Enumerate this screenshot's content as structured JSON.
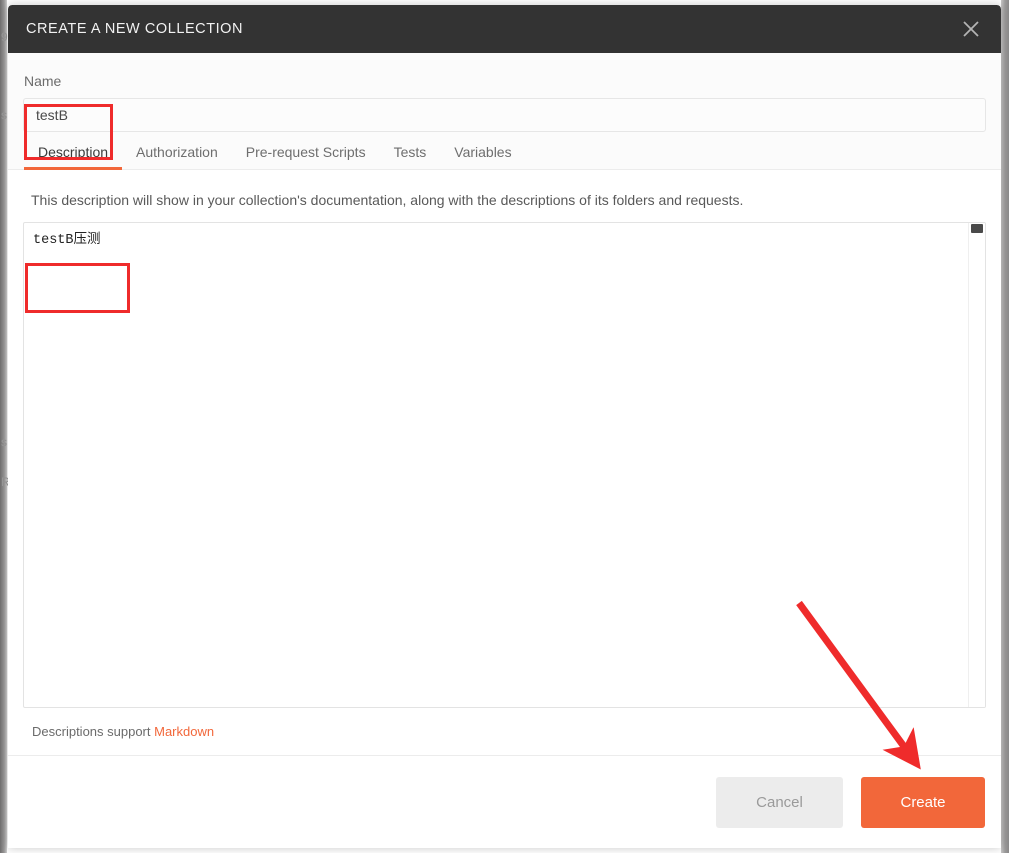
{
  "modal": {
    "title": "CREATE A NEW COLLECTION",
    "close_icon": "close-icon"
  },
  "name_section": {
    "label": "Name",
    "value": "testB",
    "placeholder": ""
  },
  "tabs": [
    {
      "label": "Description",
      "active": true
    },
    {
      "label": "Authorization",
      "active": false
    },
    {
      "label": "Pre-request Scripts",
      "active": false
    },
    {
      "label": "Tests",
      "active": false
    },
    {
      "label": "Variables",
      "active": false
    }
  ],
  "description": {
    "hint": "This description will show in your collection's documentation, along with the descriptions of its folders and requests.",
    "value": "testB压测",
    "placeholder": "",
    "markdown_note_prefix": "Descriptions support ",
    "markdown_link": "Markdown"
  },
  "footer": {
    "cancel_label": "Cancel",
    "create_label": "Create"
  },
  "backdrop": {
    "ghost_1": "s",
    "ghost_2": "R",
    "ghost_3": "9"
  },
  "colors": {
    "accent_orange": "#f2673a",
    "header_dark": "#333333",
    "annotation_red": "#ef2b2b",
    "cancel_grey": "#ececec"
  }
}
